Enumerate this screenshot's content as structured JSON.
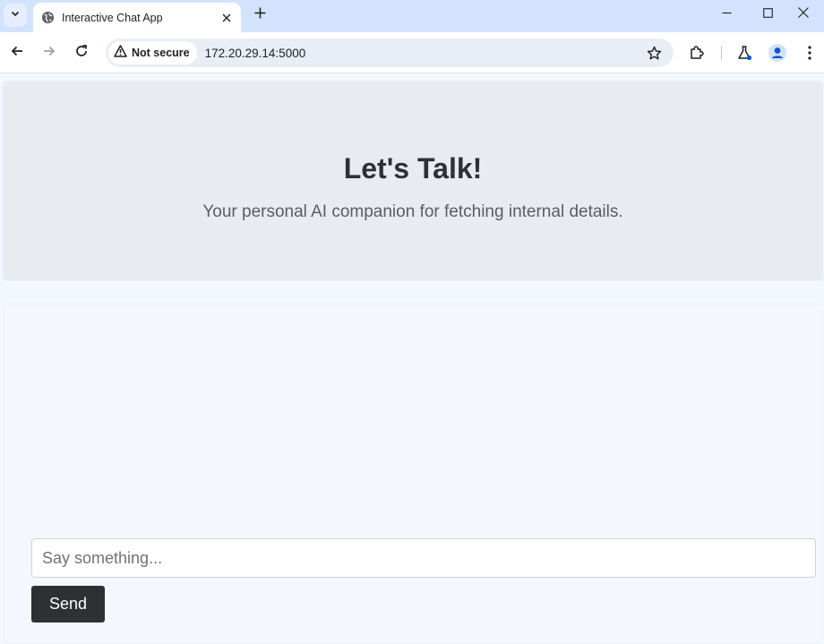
{
  "browser": {
    "tab": {
      "title": "Interactive Chat App",
      "favicon": "globe-icon"
    },
    "address_bar": {
      "security_label": "Not secure",
      "url": "172.20.29.14:5000"
    },
    "icons": {
      "back": "arrow-left-icon",
      "forward": "arrow-right-icon",
      "reload": "reload-icon",
      "bookmark": "star-icon",
      "extensions": "puzzle-icon",
      "labs": "flask-icon",
      "profile": "avatar-icon",
      "menu": "kebab-icon"
    },
    "colors": {
      "tabbar_bg": "#d3e3fd",
      "omnibox_bg": "#e9eef6",
      "profile_accent": "#0b57d0"
    }
  },
  "page": {
    "hero": {
      "title": "Let's Talk!",
      "subtitle": "Your personal AI companion for fetching internal details."
    },
    "chat": {
      "messages": [],
      "input_placeholder": "Say something...",
      "input_value": "",
      "send_label": "Send"
    },
    "colors": {
      "page_bg": "#f3f7fe",
      "hero_bg": "#e8ecf1",
      "send_button_bg": "#2f3033",
      "text_dark": "#2f3033"
    }
  }
}
